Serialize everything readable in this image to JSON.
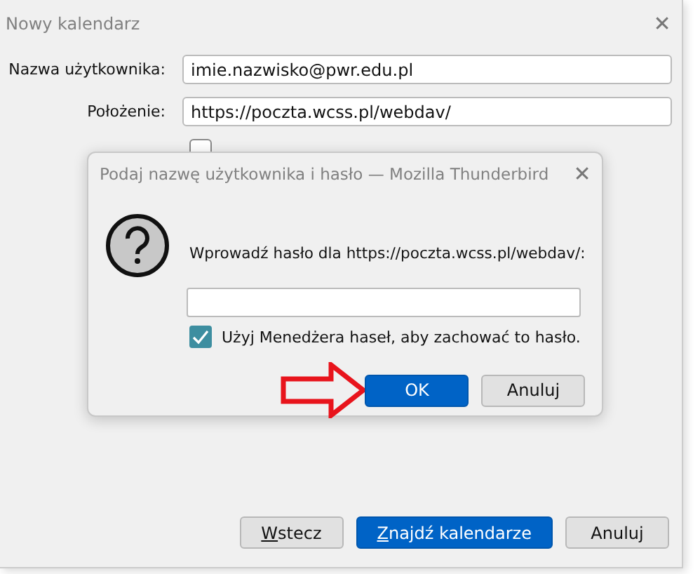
{
  "window": {
    "title": "Nowy kalendarz",
    "close": "✕"
  },
  "fields": [
    {
      "label": "Nazwa użytkownika:",
      "value": "imie.nazwisko@pwr.edu.pl"
    },
    {
      "label": "Położenie:",
      "value": "https://poczta.wcss.pl/webdav/"
    }
  ],
  "no_login_checkbox": {
    "checked": false
  },
  "buttons": [
    {
      "label": "Wstecz",
      "kind": "normal"
    },
    {
      "label": "Znajdź kalendarze",
      "kind": "primary"
    },
    {
      "label": "Anuluj",
      "kind": "normal"
    }
  ],
  "dialog": {
    "title": "Podaj nazwę użytkownika i hasło — Mozilla Thunderbird",
    "close": "✕",
    "message": "Wprowadź hasło dla https://poczta.wcss.pl/webdav/:",
    "remember": {
      "label": "Użyj Menedżera haseł, aby zachować to hasło.",
      "checked": true
    },
    "buttons": [
      {
        "label": "OK",
        "kind": "primary"
      },
      {
        "label": "Anuluj",
        "kind": "normal"
      }
    ]
  }
}
